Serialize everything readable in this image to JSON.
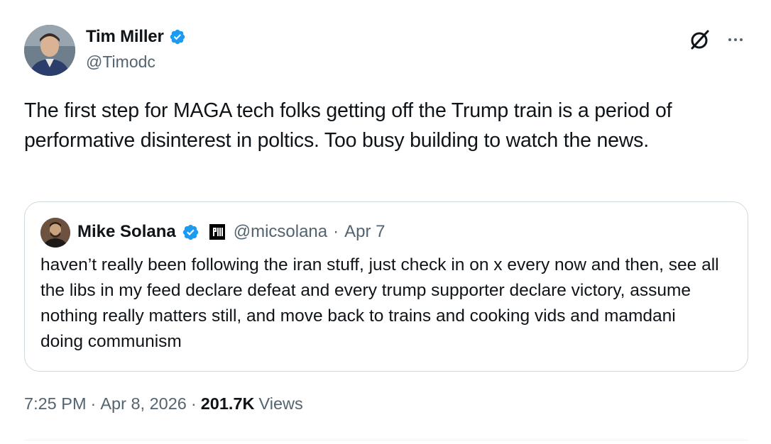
{
  "author": {
    "display_name": "Tim Miller",
    "handle": "@Timodc",
    "verified": true
  },
  "tweet": {
    "text": "The first step for MAGA tech folks getting off the Trump train is a period of performative disinterest in poltics. Too busy building to watch the news."
  },
  "quoted": {
    "display_name": "Mike Solana",
    "verified": true,
    "affiliation_badge": "PIRATE",
    "handle": "@micsolana",
    "separator": "·",
    "date": "Apr 7",
    "text": "haven’t really been following the iran stuff, just check in on x every now and then, see all the libs in my feed declare defeat and every trump supporter declare victory, assume nothing really matters still, and move back to trains and cooking vids and mamdani doing communism"
  },
  "footer": {
    "time": "7:25 PM",
    "separator": "·",
    "date": "Apr 8, 2026",
    "separator2": "·",
    "views_count": "201.7K",
    "views_label": "Views"
  },
  "icons": {
    "verified": "verified-badge-icon",
    "grok": "grok-icon",
    "more": "more-options-icon"
  },
  "colors": {
    "verified_blue": "#1d9bf0",
    "text_primary": "#0f1419",
    "text_secondary": "#536471",
    "border": "#cfd9de"
  }
}
